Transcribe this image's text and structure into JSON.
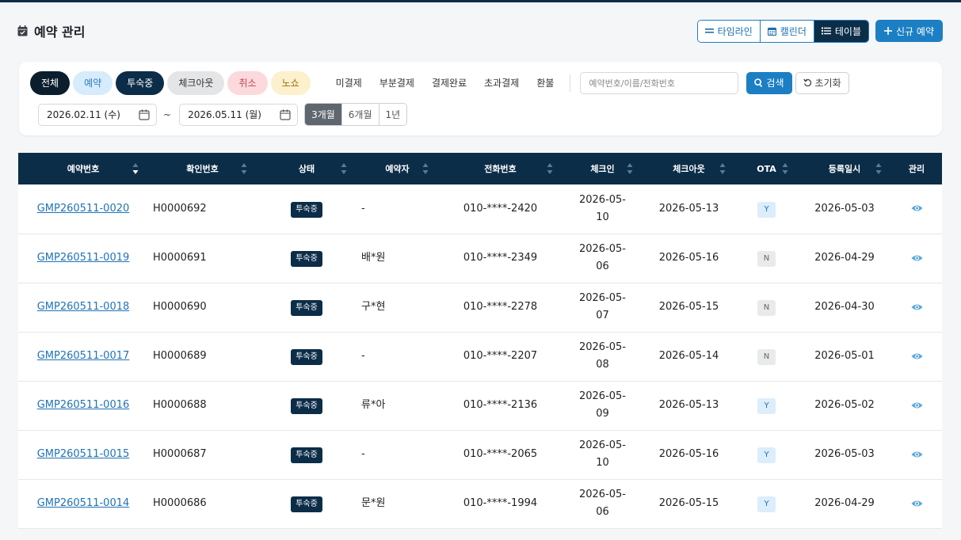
{
  "header": {
    "title": "예약 관리",
    "views": [
      {
        "icon": "timeline-icon",
        "label": "타임라인"
      },
      {
        "icon": "calendar-icon",
        "label": "캘린더"
      },
      {
        "icon": "list-icon",
        "label": "테이블"
      }
    ],
    "active_view": "테이블",
    "new_button": "신규 예약"
  },
  "filters": {
    "status_pills": [
      "전체",
      "예약",
      "투숙중",
      "체크아웃",
      "취소",
      "노쇼"
    ],
    "payment_filters": [
      "미결제",
      "부분결제",
      "결제완료",
      "초과결제",
      "환불"
    ],
    "search_placeholder": "예약번호/이름/전화번호",
    "search_button": "검색",
    "reset_button": "초기화",
    "date_from": "2026.02.11 (수)",
    "date_sep": "~",
    "date_to": "2026.05.11 (월)",
    "range_buttons": [
      "3개월",
      "6개월",
      "1년"
    ],
    "active_range": "3개월"
  },
  "table": {
    "columns": [
      "예약번호",
      "확인번호",
      "상태",
      "예약자",
      "전화번호",
      "체크인",
      "체크아웃",
      "OTA",
      "등록일시",
      "관리"
    ],
    "rows": [
      {
        "res_no": "GMP260511-0020",
        "confirm_no": "H0000692",
        "status": "투숙중",
        "guest": "-",
        "phone": "010-****-2420",
        "checkin_a": "2026-05-",
        "checkin_b": "10",
        "checkout": "2026-05-13",
        "ota": "Y",
        "registered": "2026-05-03"
      },
      {
        "res_no": "GMP260511-0019",
        "confirm_no": "H0000691",
        "status": "투숙중",
        "guest": "배*원",
        "phone": "010-****-2349",
        "checkin_a": "2026-05-",
        "checkin_b": "06",
        "checkout": "2026-05-16",
        "ota": "N",
        "registered": "2026-04-29"
      },
      {
        "res_no": "GMP260511-0018",
        "confirm_no": "H0000690",
        "status": "투숙중",
        "guest": "구*현",
        "phone": "010-****-2278",
        "checkin_a": "2026-05-",
        "checkin_b": "07",
        "checkout": "2026-05-15",
        "ota": "N",
        "registered": "2026-04-30"
      },
      {
        "res_no": "GMP260511-0017",
        "confirm_no": "H0000689",
        "status": "투숙중",
        "guest": "-",
        "phone": "010-****-2207",
        "checkin_a": "2026-05-",
        "checkin_b": "08",
        "checkout": "2026-05-14",
        "ota": "N",
        "registered": "2026-05-01"
      },
      {
        "res_no": "GMP260511-0016",
        "confirm_no": "H0000688",
        "status": "투숙중",
        "guest": "류*아",
        "phone": "010-****-2136",
        "checkin_a": "2026-05-",
        "checkin_b": "09",
        "checkout": "2026-05-13",
        "ota": "Y",
        "registered": "2026-05-02"
      },
      {
        "res_no": "GMP260511-0015",
        "confirm_no": "H0000687",
        "status": "투숙중",
        "guest": "-",
        "phone": "010-****-2065",
        "checkin_a": "2026-05-",
        "checkin_b": "10",
        "checkout": "2026-05-16",
        "ota": "Y",
        "registered": "2026-05-03"
      },
      {
        "res_no": "GMP260511-0014",
        "confirm_no": "H0000686",
        "status": "투숙중",
        "guest": "문*원",
        "phone": "010-****-1994",
        "checkin_a": "2026-05-",
        "checkin_b": "06",
        "checkout": "2026-05-15",
        "ota": "Y",
        "registered": "2026-04-29"
      }
    ]
  },
  "colors": {
    "primary": "#1c7fc4",
    "navy": "#0c2d48",
    "link": "#1f72b8"
  }
}
